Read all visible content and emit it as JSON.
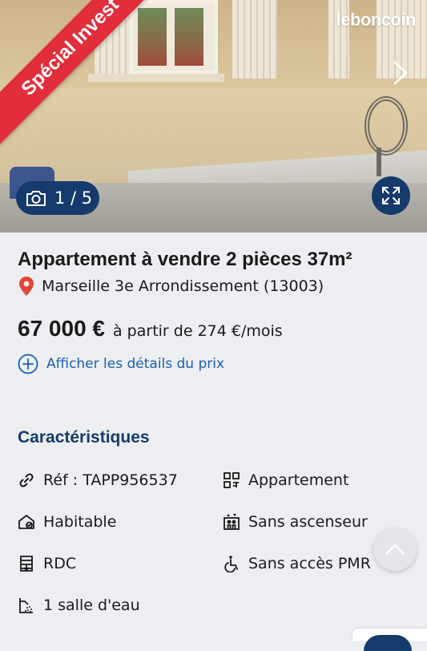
{
  "photo": {
    "ribbon_text": "Spécial Invest",
    "brand": "leboncoin",
    "counter": "1 / 5",
    "icons": [
      "camera-icon",
      "expand-icon",
      "chevron-right-icon"
    ]
  },
  "listing": {
    "title": "Appartement à vendre 2 pièces 37m²",
    "location": "Marseille 3e Arrondissement (13003)",
    "price": "67 000 €",
    "monthly": "à partir de 274 €/mois",
    "details_link": "Afficher les détails du prix"
  },
  "characteristics": {
    "title": "Caractéristiques",
    "items": [
      {
        "label": "Réf : TAPP956537",
        "icon": "link-icon"
      },
      {
        "label": "Appartement",
        "icon": "building-grid-icon"
      },
      {
        "label": "Habitable",
        "icon": "house-check-icon"
      },
      {
        "label": "Sans ascenseur",
        "icon": "elevator-icon"
      },
      {
        "label": "RDC",
        "icon": "floor-icon"
      },
      {
        "label": "Sans accès PMR",
        "icon": "wheelchair-icon"
      },
      {
        "label": "1 salle d'eau",
        "icon": "shower-icon"
      }
    ]
  },
  "colors": {
    "navy": "#153a6b",
    "ribbon": "#e22d3a",
    "link": "#1a5fb4",
    "pin": "#e0463a"
  }
}
